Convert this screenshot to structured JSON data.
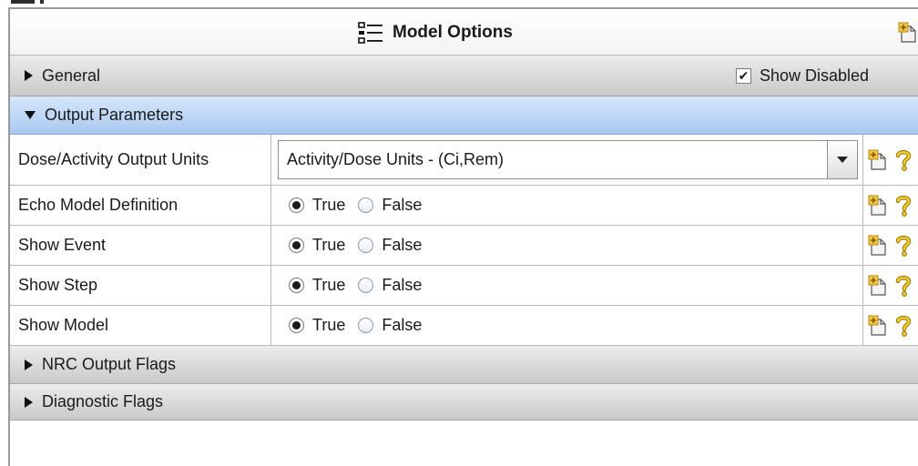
{
  "panel": {
    "title": "Model Options",
    "title_icon": "list-icon",
    "pin_icon": "new-item-icon"
  },
  "sections": {
    "general": {
      "label": "General",
      "expanded": false
    },
    "show_disabled": {
      "label": "Show Disabled",
      "checked": true
    },
    "output_parameters": {
      "label": "Output Parameters",
      "expanded": true
    },
    "nrc_output_flags": {
      "label": "NRC Output Flags",
      "expanded": false
    },
    "diagnostic_flags": {
      "label": "Diagnostic Flags",
      "expanded": false
    }
  },
  "parameters": {
    "dose_units": {
      "label": "Dose/Activity Output Units",
      "value": "Activity/Dose Units - (Ci,Rem)"
    },
    "echo_model_definition": {
      "label": "Echo Model Definition",
      "selected": "True"
    },
    "show_event": {
      "label": "Show Event",
      "selected": "True"
    },
    "show_step": {
      "label": "Show Step",
      "selected": "True"
    },
    "show_model": {
      "label": "Show Model",
      "selected": "True"
    }
  },
  "radio_options": {
    "true_label": "True",
    "false_label": "False"
  },
  "colors": {
    "section_bar": "#d4d4d4",
    "active_section": "#bcd6f5",
    "border": "#b8b8b8",
    "help_icon": "#e8c21a"
  },
  "icons": {
    "row_action": "new-item-icon",
    "row_help": "help-icon"
  }
}
